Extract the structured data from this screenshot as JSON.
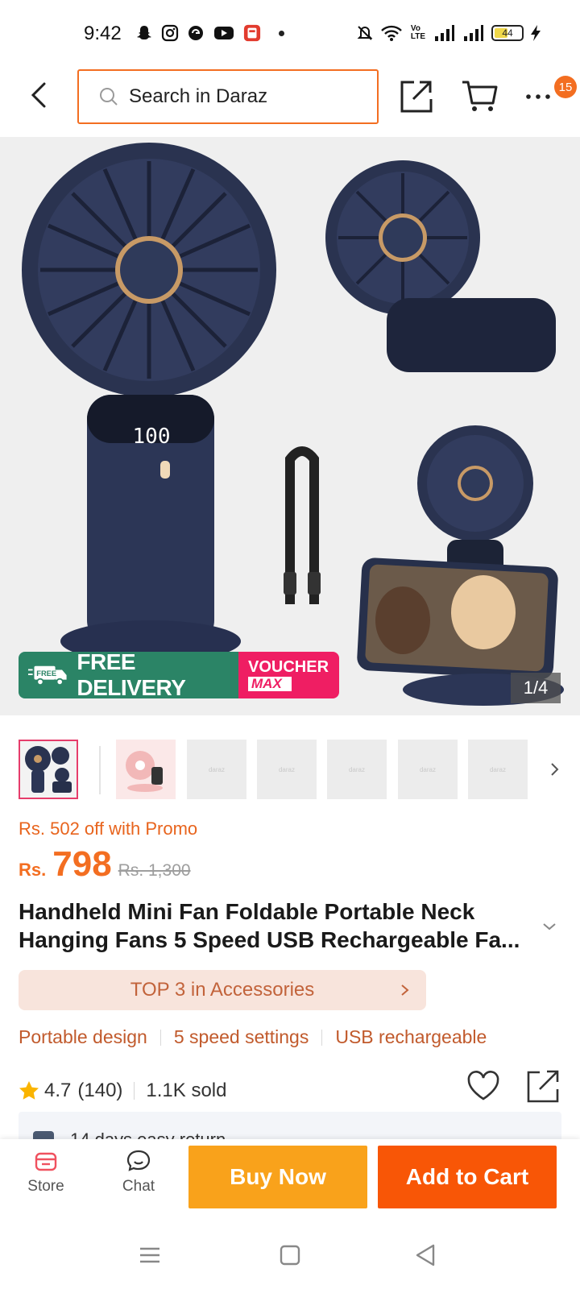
{
  "status_bar": {
    "time": "9:42",
    "battery": "44",
    "battery_fraction": 0.44
  },
  "header": {
    "search_placeholder": "Search in Daraz",
    "cart_badge": "15"
  },
  "hero": {
    "banner_free_tag": "FREE",
    "banner_delivery": "FREE DELIVERY",
    "banner_voucher": "VOUCHER",
    "banner_max": "MAX",
    "counter": "1/4",
    "display_reading": "100"
  },
  "thumbnails": [
    {
      "label": ""
    },
    {
      "label": ""
    },
    {
      "label": "daraz"
    },
    {
      "label": "daraz"
    },
    {
      "label": "daraz"
    },
    {
      "label": "daraz"
    },
    {
      "label": "daraz"
    }
  ],
  "price": {
    "promo": "Rs. 502 off with Promo",
    "currency": "Rs.",
    "current": "798",
    "original": "Rs. 1,300"
  },
  "product": {
    "title": "Handheld Mini Fan Foldable Portable Neck Hanging Fans 5 Speed USB Rechargeable Fa...",
    "rank": "TOP 3 in Accessories",
    "features": [
      "Portable design",
      "5 speed settings",
      "USB rechargeable"
    ],
    "rating": "4.7",
    "reviews": "(140)",
    "sold": "1.1K sold",
    "return_policy": "14 days easy return"
  },
  "bottom_bar": {
    "store": "Store",
    "chat": "Chat",
    "buy_now": "Buy Now",
    "add_to_cart": "Add to Cart"
  },
  "colors": {
    "brand_orange": "#f85606",
    "buy_now": "#f9a21b",
    "rank_bg": "#f8e4dc",
    "delivery_green": "#2b8466",
    "voucher_pink": "#ef1e63"
  }
}
